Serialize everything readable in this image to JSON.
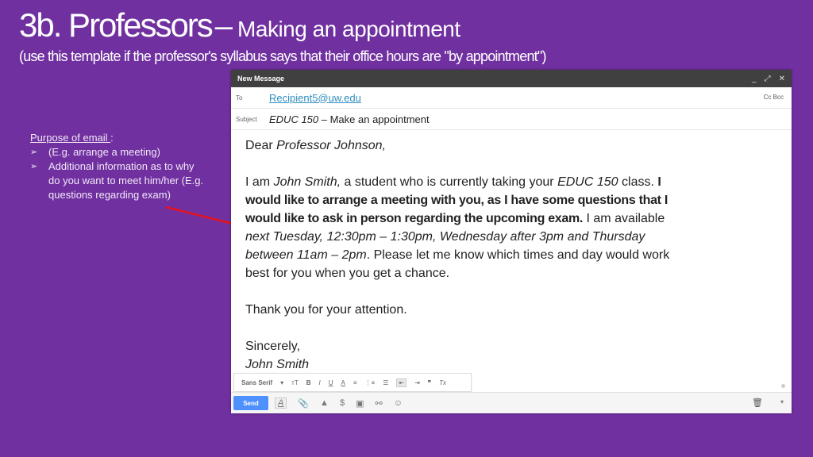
{
  "slide": {
    "title_main": "3b. Professors",
    "title_dash": "–",
    "title_sub": "Making  an  appointment",
    "subtitle": "(use  this  template  if the professor's  syllabus  says  that  their  office  hours  are  \"by  appointment\")",
    "purpose": {
      "heading": "Purpose of email ",
      "colon": ":",
      "bullet_glyph": "➢",
      "items": [
        "(E.g. arrange a meeting)",
        "Additional information as to why do you want to meet him/her (E.g. questions regarding exam)"
      ]
    },
    "arrow_color": "#e8131b",
    "background_color": "#7030a0"
  },
  "compose": {
    "window_title": "New Message",
    "controls": {
      "minimize": "_",
      "popout": "⤢",
      "close": "✕"
    },
    "to_label": "To",
    "to_value": "Recipient5@uw.edu",
    "cc_bcc": "Cc  Bcc",
    "subject_label": "Subject",
    "subject_course": "EDUC 150",
    "subject_rest": " – Make an appointment",
    "body": {
      "greeting_plain": "Dear ",
      "greeting_name": "Professor Johnson,",
      "p1_a": "I am ",
      "p1_name": "John Smith,",
      "p1_b": " a student who is currently taking your ",
      "p1_course": "EDUC 150",
      "p1_c": " class. ",
      "p1_bold": "I would like to arrange a meeting with you, as I have some questions that I would like to ask in person regarding the upcoming exam.",
      "p1_d": " I am available ",
      "p1_times": "next Tuesday, 12:30pm – 1:30pm, Wednesday after 3pm and Thursday between 11am – 2pm",
      "p1_e": ". Please let me know which times and day would work best for you when you get a chance.",
      "thanks": "Thank you for your attention.",
      "closing": "Sincerely,",
      "signature": "John Smith"
    },
    "format_toolbar": {
      "font": "Sans Serif",
      "dropdown": "▾",
      "size": "ᴛT",
      "bold": "B",
      "italic": "I",
      "underline": "U",
      "text_color": "A",
      "align": "≡",
      "numbered_list": "⋮≡",
      "bulleted_list": "☰",
      "indent_less": "⇤",
      "indent_more": "⇥",
      "quote": "❞",
      "clear_format": "Tx"
    },
    "footer": {
      "send": "Send",
      "formatting": "A",
      "attach": "📎",
      "drive": "▲",
      "money": "$",
      "photo": "▣",
      "link": "⚯",
      "emoji": "☺",
      "trash": "🗑",
      "more": "▾"
    }
  }
}
